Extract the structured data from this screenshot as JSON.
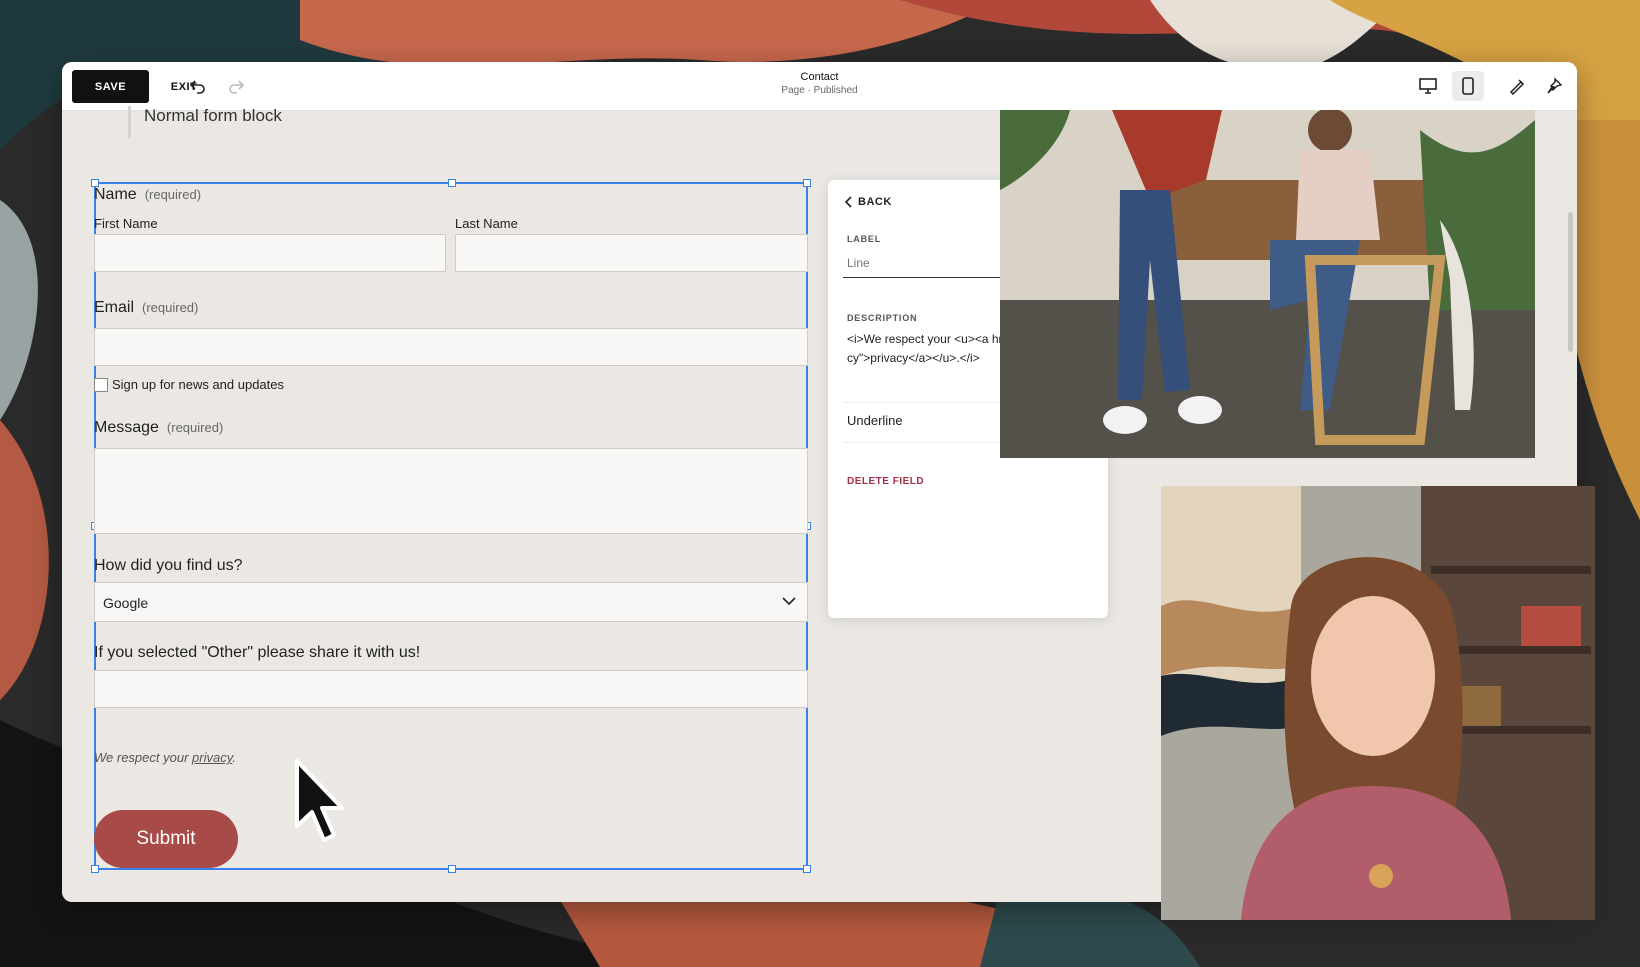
{
  "toolbar": {
    "save_label": "SAVE",
    "exit_label": "EXIT",
    "page_title": "Contact",
    "page_status": "Page · Published",
    "icons": [
      "undo-icon",
      "redo-icon",
      "desktop-icon",
      "mobile-icon",
      "style-icon",
      "pin-icon"
    ]
  },
  "content": {
    "block_label": "Normal form block"
  },
  "form": {
    "name_label": "Name",
    "name_req": "(required)",
    "first_name": "First Name",
    "last_name": "Last Name",
    "email_label": "Email",
    "email_req": "(required)",
    "newsletter": "Sign up for news and updates",
    "message_label": "Message",
    "message_req": "(required)",
    "find_label": "How did you find us?",
    "find_value": "Google",
    "other_label": "If you selected \"Other\" please share it with us!",
    "privacy_prefix": "We respect your ",
    "privacy_link": "privacy",
    "privacy_suffix": ".",
    "submit_label": "Submit"
  },
  "panel": {
    "back_label": "BACK",
    "label_heading": "LABEL",
    "label_placeholder": "Line",
    "description_heading": "DESCRIPTION",
    "description_value": "<i>We respect your <u><a href=\"/legal/privacy\">privacy</a></u>.</i>",
    "underline_label": "Underline",
    "underline_on": false,
    "delete_label": "DELETE FIELD"
  },
  "colors": {
    "accent": "#3b82e8",
    "submit": "#a84a47",
    "delete": "#a3324a"
  }
}
